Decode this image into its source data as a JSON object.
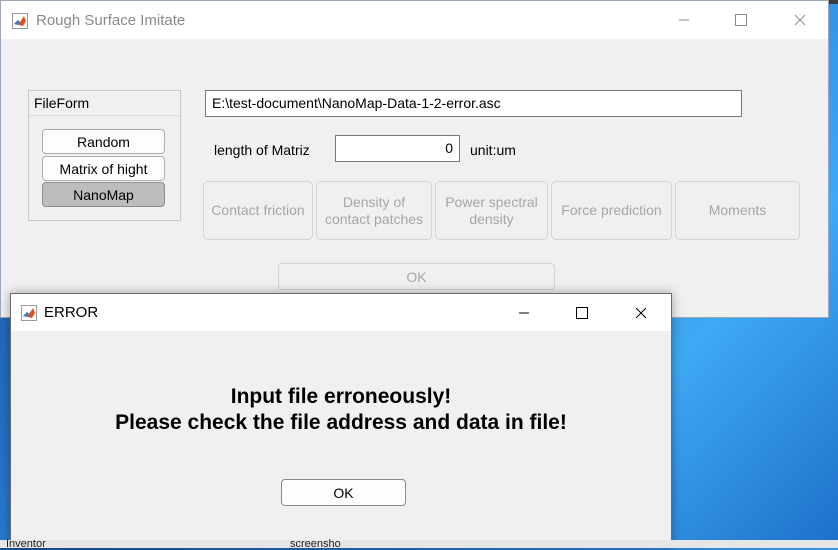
{
  "main_window": {
    "title": "Rough Surface Imitate",
    "file_form": {
      "title": "FileForm",
      "options": [
        "Random",
        "Matrix of hight",
        "NanoMap"
      ],
      "selected": "NanoMap"
    },
    "file_path": "E:\\test-document\\NanoMap-Data-1-2-error.asc",
    "length_label": "length of Matriz",
    "length_value": "0",
    "unit_label": "unit:um",
    "function_buttons": {
      "contact_friction": "Contact friction",
      "density_line1": "Density of",
      "density_line2": "contact patches",
      "power_line1": "Power spectral",
      "power_line2": "density",
      "force_prediction": "Force prediction",
      "moments": "Moments"
    },
    "ok_label": "OK"
  },
  "error_dialog": {
    "title": "ERROR",
    "message_line1": "Input file erroneously!",
    "message_line2": "Please check the file address and data in file!",
    "ok_label": "OK"
  },
  "taskbar": {
    "item1": "Inventor",
    "item2": "screensho"
  },
  "colors": {
    "window_bg": "#f0f0f0",
    "titlebar_bg": "#ffffff",
    "selected_toggle": "#bdbdbd",
    "disabled_text": "#a6a6a6",
    "desktop_blue": "#2a7fd6"
  }
}
